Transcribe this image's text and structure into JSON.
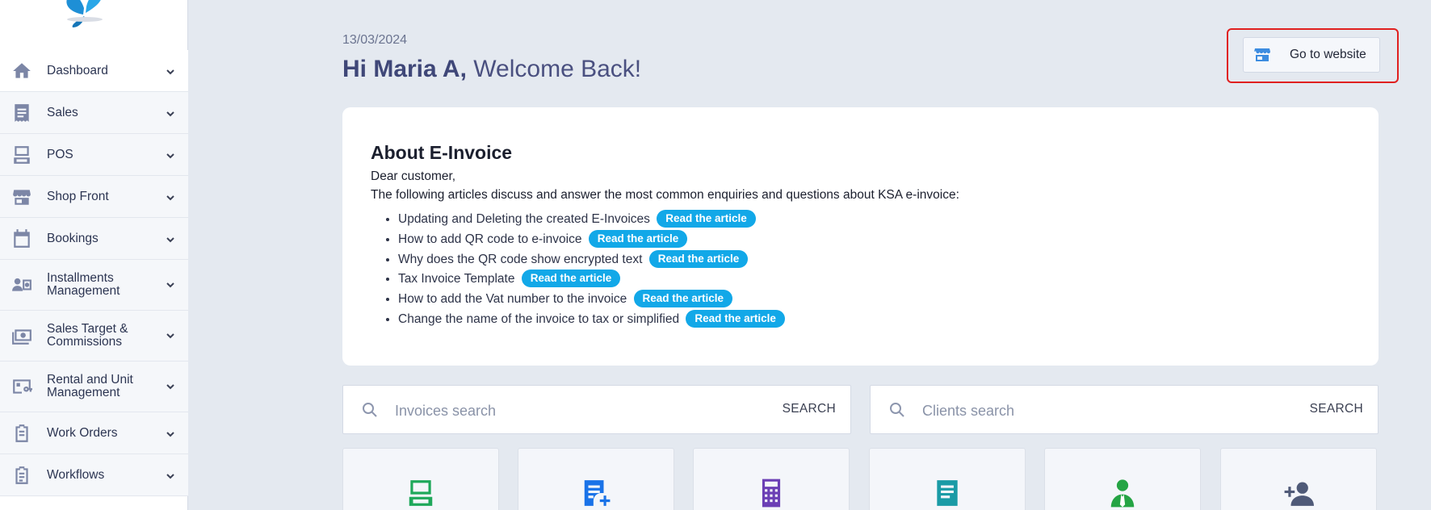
{
  "sidebar": {
    "items": [
      {
        "label": "Dashboard",
        "icon": "home-icon"
      },
      {
        "label": "Sales",
        "icon": "receipt-icon"
      },
      {
        "label": "POS",
        "icon": "pos-terminal-icon"
      },
      {
        "label": "Shop Front",
        "icon": "store-icon"
      },
      {
        "label": "Bookings",
        "icon": "calendar-icon"
      },
      {
        "label": "Installments Management",
        "icon": "installments-icon"
      },
      {
        "label": "Sales Target & Commissions",
        "icon": "money-icon"
      },
      {
        "label": "Rental and Unit Management",
        "icon": "rental-key-icon"
      },
      {
        "label": "Work Orders",
        "icon": "clipboard-icon"
      },
      {
        "label": "Workflows",
        "icon": "clipboard-list-icon"
      }
    ]
  },
  "header": {
    "date": "13/03/2024",
    "greeting_name": "Hi Maria  A,",
    "greeting_rest": " Welcome Back!",
    "goto_website": "Go to website"
  },
  "about": {
    "title": "About E-Invoice",
    "intro1": "Dear customer,",
    "intro2": "The following articles discuss and answer the most common enquiries and questions about KSA e-invoice:",
    "read_label": "Read the article",
    "articles": [
      "Updating and Deleting the created E-Invoices",
      "How to add QR code to e-invoice",
      "Why does the QR code show encrypted text",
      "Tax Invoice Template",
      "How to add the Vat number to the invoice",
      "Change the name of the invoice to tax or simplified"
    ]
  },
  "search": {
    "invoices_placeholder": "Invoices search",
    "clients_placeholder": "Clients search",
    "button": "SEARCH"
  },
  "tiles": [
    {
      "icon": "pos-terminal-icon",
      "color": "#1fa85a"
    },
    {
      "icon": "new-invoice-icon",
      "color": "#1a73e8"
    },
    {
      "icon": "calculator-icon",
      "color": "#6b3fb5"
    },
    {
      "icon": "document-icon",
      "color": "#1a9ba6"
    },
    {
      "icon": "client-icon",
      "color": "#25a444"
    },
    {
      "icon": "add-user-icon",
      "color": "#4f5a78"
    }
  ],
  "colors": {
    "accent": "#12a8e8",
    "highlight_border": "#e0201f"
  }
}
